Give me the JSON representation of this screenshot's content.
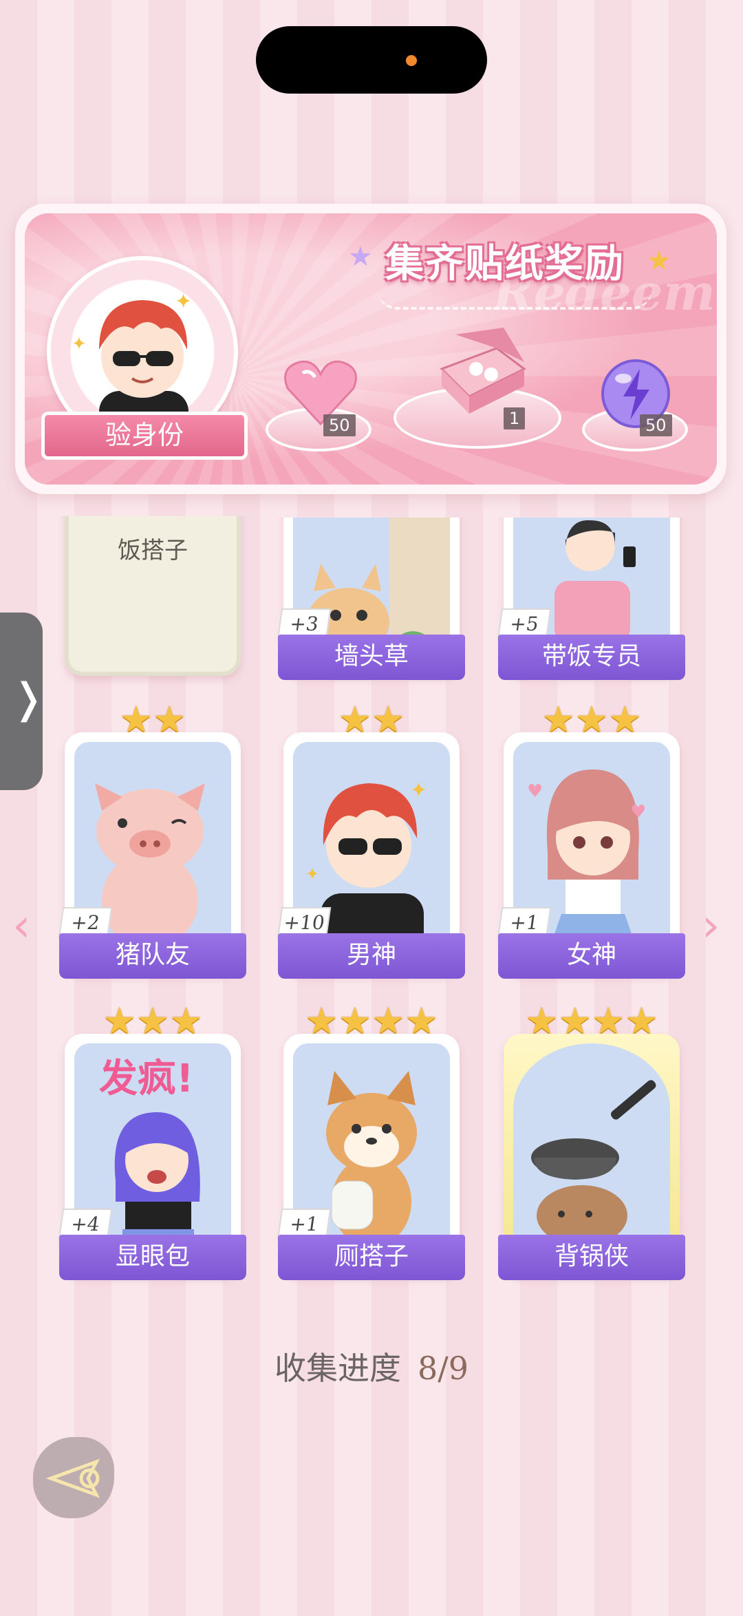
{
  "banner": {
    "title": "集齐贴纸奖励",
    "ghost_text": "Redeem",
    "verify_button": "验身份",
    "rewards": [
      {
        "icon": "pink-heart-gem-icon",
        "count": "50"
      },
      {
        "icon": "gift-box-icon",
        "count": "1"
      },
      {
        "icon": "purple-lightning-orb-icon",
        "count": "50"
      }
    ]
  },
  "cards": [
    {
      "name": "饭搭子",
      "locked": true,
      "stars": 0,
      "count": ""
    },
    {
      "name": "墙头草",
      "locked": false,
      "stars": 0,
      "count": "+3",
      "icon": "kitten-icon"
    },
    {
      "name": "带饭专员",
      "locked": false,
      "stars": 0,
      "count": "+5",
      "icon": "girl-with-phone-icon"
    },
    {
      "name": "猪队友",
      "locked": false,
      "stars": 2,
      "count": "+2",
      "icon": "pig-icon"
    },
    {
      "name": "男神",
      "locked": false,
      "stars": 2,
      "count": "+10",
      "icon": "cool-boy-icon"
    },
    {
      "name": "女神",
      "locked": false,
      "stars": 3,
      "count": "+1",
      "icon": "cute-girl-icon"
    },
    {
      "name": "显眼包",
      "locked": false,
      "stars": 3,
      "count": "+4",
      "icon": "crazy-girl-icon"
    },
    {
      "name": "厕搭子",
      "locked": false,
      "stars": 4,
      "count": "+1",
      "icon": "shiba-dog-icon"
    },
    {
      "name": "背锅侠",
      "locked": false,
      "stars": 4,
      "count": "",
      "icon": "capybara-with-pan-icon",
      "gold": true
    }
  ],
  "card_overlay_text": "发疯!",
  "progress": {
    "label": "收集进度",
    "value": "8/9"
  },
  "colors": {
    "accent": "#8a62dc",
    "pink": "#f4a5b9",
    "star": "#f6c243"
  }
}
